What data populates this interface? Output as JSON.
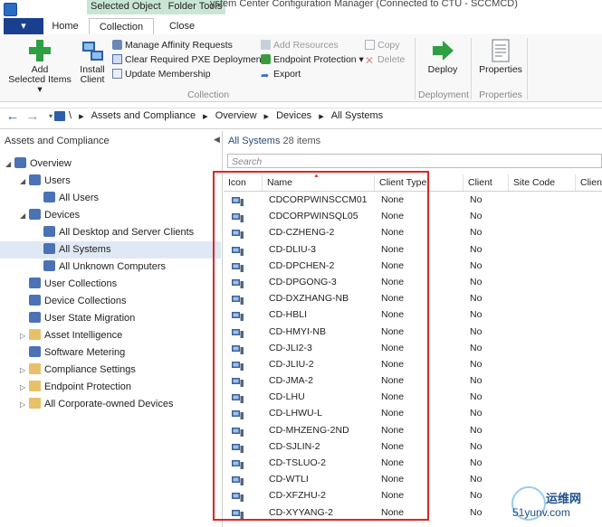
{
  "titlebar": {
    "context_tabs": [
      "Selected Object",
      "Folder Tools"
    ],
    "window_title": "ystem Center Configuration Manager (Connected to CTU - SCCMCD)"
  },
  "ribbon_tabs": [
    "Home",
    "Collection",
    "Close"
  ],
  "ribbon": {
    "add_selected_items": "Add\nSelected Items ▾",
    "install_client": "Install\nClient",
    "manage_affinity": "Manage Affinity Requests",
    "clear_pxe": "Clear Required PXE Deployments",
    "update_membership": "Update Membership",
    "add_resources": "Add Resources",
    "endpoint_protection": "Endpoint Protection ▾",
    "export": "Export",
    "copy": "Copy",
    "delete": "Delete",
    "deploy": "Deploy",
    "properties": "Properties",
    "group_collection": "Collection",
    "group_deployment": "Deployment",
    "group_properties": "Properties"
  },
  "address": {
    "crumbs": [
      "\\",
      "▸",
      "Assets and Compliance",
      "▸",
      "Overview",
      "▸",
      "Devices",
      "▸",
      "All Systems"
    ]
  },
  "nav": {
    "header": "Assets and Compliance",
    "items": [
      {
        "label": "Overview",
        "indent": 0,
        "exp": "◢"
      },
      {
        "label": "Users",
        "indent": 1,
        "exp": "◢"
      },
      {
        "label": "All Users",
        "indent": 2,
        "exp": ""
      },
      {
        "label": "Devices",
        "indent": 1,
        "exp": "◢"
      },
      {
        "label": "All Desktop and Server Clients",
        "indent": 2,
        "exp": ""
      },
      {
        "label": "All Systems",
        "indent": 2,
        "exp": "",
        "selected": true
      },
      {
        "label": "All Unknown Computers",
        "indent": 2,
        "exp": ""
      },
      {
        "label": "User Collections",
        "indent": 1,
        "exp": ""
      },
      {
        "label": "Device Collections",
        "indent": 1,
        "exp": ""
      },
      {
        "label": "User State Migration",
        "indent": 1,
        "exp": ""
      },
      {
        "label": "Asset Intelligence",
        "indent": 1,
        "exp": "▷"
      },
      {
        "label": "Software Metering",
        "indent": 1,
        "exp": ""
      },
      {
        "label": "Compliance Settings",
        "indent": 1,
        "exp": "▷"
      },
      {
        "label": "Endpoint Protection",
        "indent": 1,
        "exp": "▷"
      },
      {
        "label": "All Corporate-owned Devices",
        "indent": 1,
        "exp": "▷"
      }
    ]
  },
  "list": {
    "title": "All Systems",
    "count": "28 items",
    "search_placeholder": "Search",
    "columns": [
      "Icon",
      "Name",
      "Client Type",
      "Client",
      "Site Code",
      "Client"
    ],
    "rows": [
      {
        "name": "CDCORPWINSCCM01",
        "type": "None",
        "client": "No"
      },
      {
        "name": "CDCORPWINSQL05",
        "type": "None",
        "client": "No"
      },
      {
        "name": "CD-CZHENG-2",
        "type": "None",
        "client": "No"
      },
      {
        "name": "CD-DLIU-3",
        "type": "None",
        "client": "No"
      },
      {
        "name": "CD-DPCHEN-2",
        "type": "None",
        "client": "No"
      },
      {
        "name": "CD-DPGONG-3",
        "type": "None",
        "client": "No"
      },
      {
        "name": "CD-DXZHANG-NB",
        "type": "None",
        "client": "No"
      },
      {
        "name": "CD-HBLI",
        "type": "None",
        "client": "No"
      },
      {
        "name": "CD-HMYI-NB",
        "type": "None",
        "client": "No"
      },
      {
        "name": "CD-JLI2-3",
        "type": "None",
        "client": "No"
      },
      {
        "name": "CD-JLIU-2",
        "type": "None",
        "client": "No"
      },
      {
        "name": "CD-JMA-2",
        "type": "None",
        "client": "No"
      },
      {
        "name": "CD-LHU",
        "type": "None",
        "client": "No"
      },
      {
        "name": "CD-LHWU-L",
        "type": "None",
        "client": "No"
      },
      {
        "name": "CD-MHZENG-2ND",
        "type": "None",
        "client": "No"
      },
      {
        "name": "CD-SJLIN-2",
        "type": "None",
        "client": "No"
      },
      {
        "name": "CD-TSLUO-2",
        "type": "None",
        "client": "No"
      },
      {
        "name": "CD-WTLI",
        "type": "None",
        "client": "No"
      },
      {
        "name": "CD-XFZHU-2",
        "type": "None",
        "client": "No"
      },
      {
        "name": "CD-XYYANG-2",
        "type": "None",
        "client": "No"
      }
    ]
  },
  "watermark": {
    "line1": "运维网",
    "line2": "51yunv.com"
  },
  "colors": {
    "accent": "#1a3f8f",
    "highlight_box": "#e12525",
    "selection": "#dfe9f5"
  }
}
